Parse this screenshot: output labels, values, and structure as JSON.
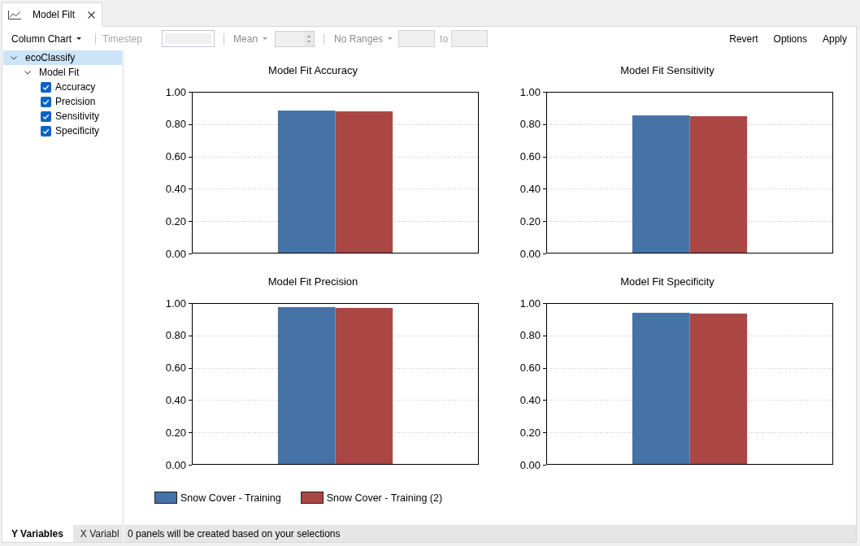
{
  "tab": {
    "title": "Model Filt",
    "selected": true
  },
  "toolbar": {
    "chart_type": {
      "label": "Column Chart",
      "disabled": false
    },
    "timestep": {
      "label": "Timestep",
      "disabled": true
    },
    "statistic": {
      "label": "Mean",
      "disabled": true
    },
    "ranges": {
      "label": "No Ranges",
      "to_label": "to",
      "disabled": true
    },
    "actions": [
      "Revert",
      "Options",
      "Apply"
    ]
  },
  "tree": [
    {
      "label": "ecoClassify",
      "expanded": true,
      "selected": true,
      "children": [
        {
          "label": "Model Fit",
          "expanded": true,
          "selected": false,
          "children": [
            {
              "label": "Accuracy",
              "checked": true,
              "selected": false
            },
            {
              "label": "Precision",
              "checked": true,
              "selected": false
            },
            {
              "label": "Sensitivity",
              "checked": true,
              "selected": false
            },
            {
              "label": "Specificity",
              "checked": true,
              "selected": false
            }
          ]
        }
      ]
    }
  ],
  "pane_tabs": [
    {
      "label": "Y Variables",
      "selected": true
    },
    {
      "label": "X Variabl",
      "selected": false
    }
  ],
  "charts": [
    {
      "chart_data": {
        "type": "bar",
        "title": "Model Fit Accuracy",
        "grid": true,
        "ylim": [
          0,
          1
        ],
        "yticks": [
          {
            "value": 0,
            "label": "0.00"
          },
          {
            "value": 0.2,
            "label": "0.20"
          },
          {
            "value": 0.4,
            "label": "0.40"
          },
          {
            "value": 0.6,
            "label": "0.60"
          },
          {
            "value": 0.8,
            "label": "0.80"
          },
          {
            "value": 1,
            "label": "1.00"
          }
        ],
        "series": [
          {
            "color": "#4572a7",
            "values": [
              0.884
            ]
          },
          {
            "color": "#aa4643",
            "values": [
              0.879
            ]
          }
        ]
      }
    },
    {
      "chart_data": {
        "type": "bar",
        "title": "Model Fit Sensitivity",
        "grid": true,
        "ylim": [
          0,
          1
        ],
        "yticks": [
          {
            "value": 0,
            "label": "0.00"
          },
          {
            "value": 0.2,
            "label": "0.20"
          },
          {
            "value": 0.4,
            "label": "0.40"
          },
          {
            "value": 0.6,
            "label": "0.60"
          },
          {
            "value": 0.8,
            "label": "0.80"
          },
          {
            "value": 1,
            "label": "1.00"
          }
        ],
        "series": [
          {
            "color": "#4572a7",
            "values": [
              0.854
            ]
          },
          {
            "color": "#aa4643",
            "values": [
              0.849
            ]
          }
        ]
      }
    },
    {
      "chart_data": {
        "type": "bar",
        "title": "Model Fit Precision",
        "grid": true,
        "ylim": [
          0,
          1
        ],
        "yticks": [
          {
            "value": 0,
            "label": "0.00"
          },
          {
            "value": 0.2,
            "label": "0.20"
          },
          {
            "value": 0.4,
            "label": "0.40"
          },
          {
            "value": 0.6,
            "label": "0.60"
          },
          {
            "value": 0.8,
            "label": "0.80"
          },
          {
            "value": 1,
            "label": "1.00"
          }
        ],
        "series": [
          {
            "color": "#4572a7",
            "values": [
              0.975
            ]
          },
          {
            "color": "#aa4643",
            "values": [
              0.97
            ]
          }
        ]
      }
    },
    {
      "chart_data": {
        "type": "bar",
        "title": "Model Fit Specificity",
        "grid": true,
        "ylim": [
          0,
          1
        ],
        "yticks": [
          {
            "value": 0,
            "label": "0.00"
          },
          {
            "value": 0.2,
            "label": "0.20"
          },
          {
            "value": 0.4,
            "label": "0.40"
          },
          {
            "value": 0.6,
            "label": "0.60"
          },
          {
            "value": 0.8,
            "label": "0.80"
          },
          {
            "value": 1,
            "label": "1.00"
          }
        ],
        "series": [
          {
            "color": "#4572a7",
            "values": [
              0.94
            ]
          },
          {
            "color": "#aa4643",
            "values": [
              0.935
            ]
          }
        ]
      }
    }
  ],
  "legend": [
    {
      "label": "Snow Cover - Training",
      "color": "#4572a7"
    },
    {
      "label": "Snow Cover - Training (2)",
      "color": "#aa4643"
    }
  ],
  "status_bar": "0 panels will be created based on your selections"
}
